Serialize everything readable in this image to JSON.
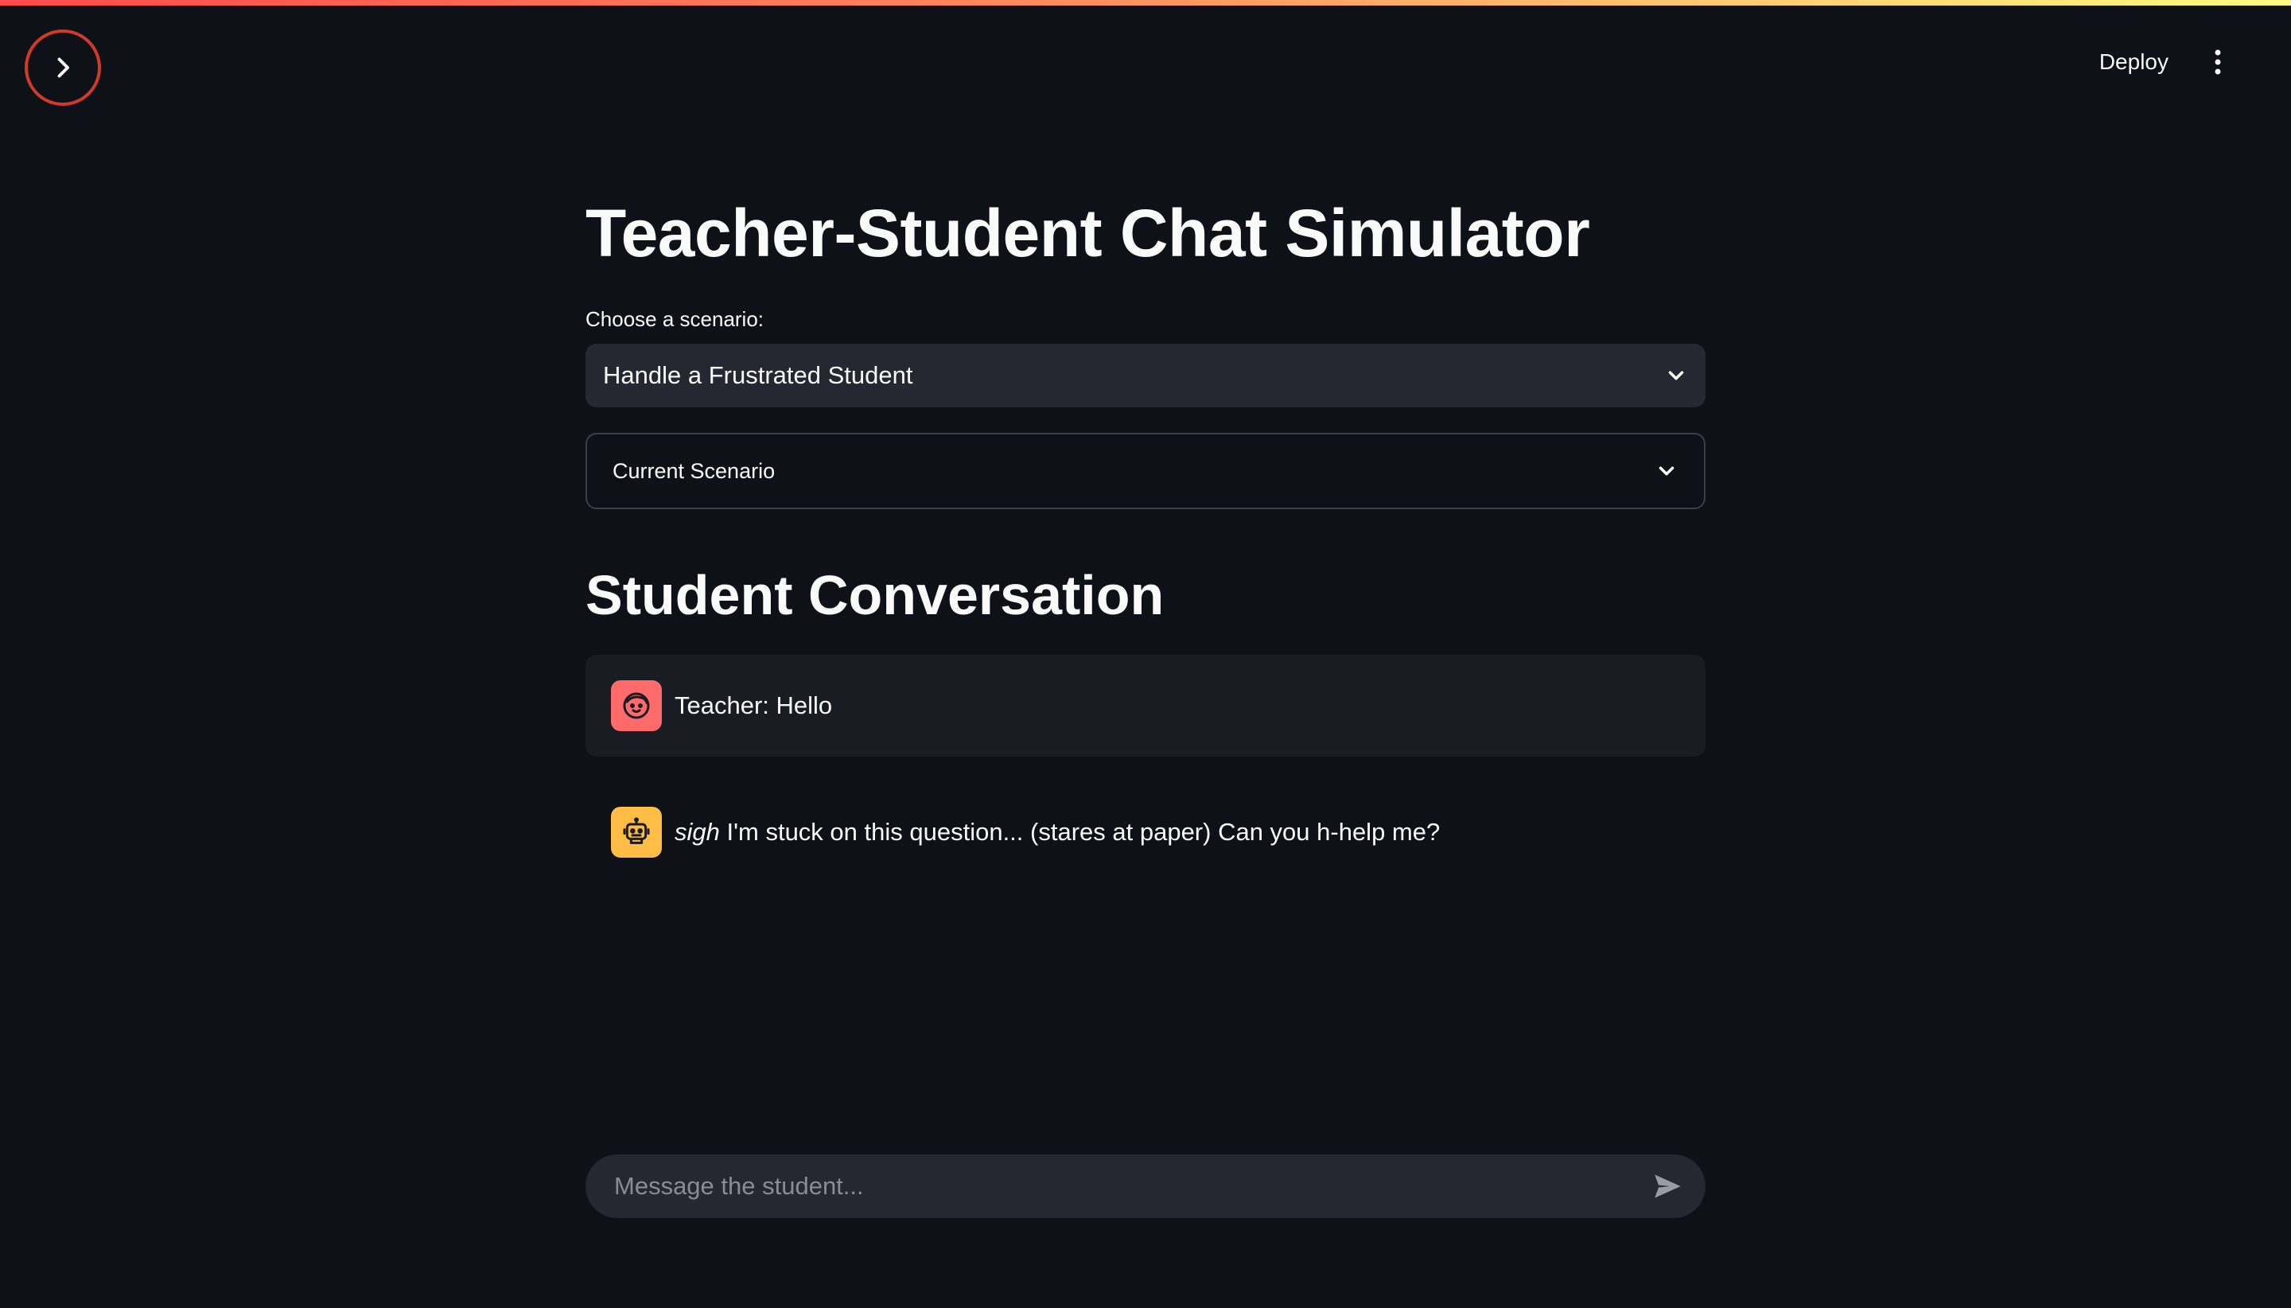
{
  "header": {
    "deploy_label": "Deploy",
    "sidebar_toggle_icon": "chevron-right-icon",
    "menu_icon": "vertical-dots-icon",
    "accent_gradient": [
      "#ff4b4b",
      "#fffd80"
    ],
    "highlight_ring_color": "#d13a26"
  },
  "main": {
    "title": "Teacher-Student Chat Simulator",
    "scenario_select": {
      "label": "Choose a scenario:",
      "selected": "Handle a Frustrated Student"
    },
    "expander": {
      "label": "Current Scenario",
      "expanded": false
    },
    "conversation_title": "Student Conversation",
    "messages": [
      {
        "role": "user",
        "avatar_icon": "face-icon",
        "avatar_color": "#ff6b6b",
        "text": "Teacher: Hello"
      },
      {
        "role": "assistant",
        "avatar_icon": "robot-icon",
        "avatar_color": "#ffbd45",
        "emphasis": "sigh",
        "text": " I'm stuck on this question... (stares at paper) Can you h-help me?"
      }
    ],
    "chat_input": {
      "placeholder": "Message the student...",
      "value": "",
      "send_icon": "send-icon"
    }
  }
}
